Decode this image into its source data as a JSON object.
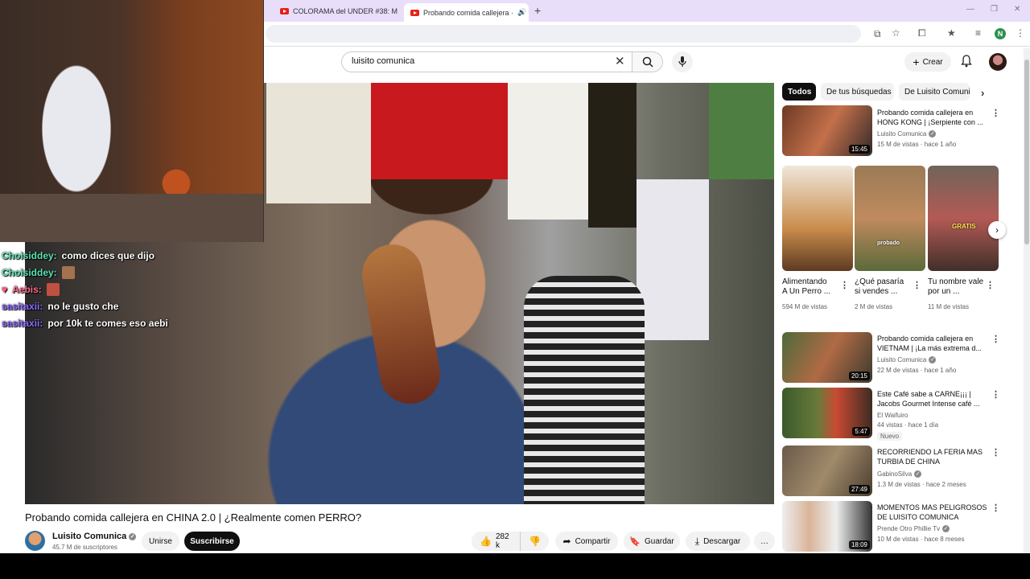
{
  "browser": {
    "tabs": [
      {
        "label": "COLORAMA del UNDER #38: M",
        "active": false
      },
      {
        "label": "Probando comida callejera ·",
        "active": true
      }
    ],
    "profile_initial": "N"
  },
  "masthead": {
    "search_value": "luisito comunica",
    "create_label": "Crear"
  },
  "chat": [
    {
      "user": "Choisiddey:",
      "message": "como dices que dijo",
      "color": "teal"
    },
    {
      "user": "Choisiddey:",
      "message": "",
      "emote": true,
      "color": "teal"
    },
    {
      "user": "Aebis:",
      "message": "",
      "emote": true,
      "color": "pink"
    },
    {
      "user": "sasitaxii:",
      "message": "no le gusto che",
      "color": "purple"
    },
    {
      "user": "sasitaxii:",
      "message": "por 10k te comes eso aebi",
      "color": "purple"
    }
  ],
  "video": {
    "title": "Probando comida callejera en CHINA 2.0 | ¿Realmente comen PERRO?",
    "channel": "Luisito Comunica",
    "subscribers": "45.7 M de suscriptores",
    "join_label": "Unirse",
    "subscribe_label": "Suscribirse",
    "likes": "282 k",
    "share_label": "Compartir",
    "save_label": "Guardar",
    "download_label": "Descargar",
    "more": "…"
  },
  "sidebar": {
    "chips": [
      "Todos",
      "De tus búsquedas",
      "De Luisito Comuni"
    ],
    "videos": [
      {
        "title": "Probando comida callejera en HONG KONG | ¡Serpiente con ...",
        "channel": "Luisito Comunica",
        "meta": "15 M de vistas · hace 1 año",
        "duration": "15:45"
      },
      {
        "title": "Probando comida callejera en VIETNAM | ¡La más extrema d...",
        "channel": "Luisito Comunica",
        "meta": "22 M de vistas · hace 1 año",
        "duration": "20:15"
      },
      {
        "title": "Este Café sabe a CARNE¡¡¡ | Jacobs Gourmet Intense café ...",
        "channel": "El Waifuiro",
        "meta": "44 vistas · hace 1 día",
        "duration": "5:47",
        "badge": "Nuevo"
      },
      {
        "title": "RECORRIENDO LA FERIA MAS TURBIA DE CHINA",
        "channel": "GabinoSilva",
        "meta": "1.3 M de vistas · hace 2 meses",
        "duration": "27:49"
      },
      {
        "title": "MOMENTOS MAS PELIGROSOS DE LUISITO COMUNICA",
        "channel": "Prende Otro Phillie Tv",
        "meta": "10 M de vistas · hace 8 meses",
        "duration": "18:09"
      }
    ],
    "shorts": [
      {
        "title": "Alimentando A Un Perro ...",
        "views": "594 M de vistas"
      },
      {
        "title": "¿Qué pasaría si vendes ...",
        "views": "2 M de vistas"
      },
      {
        "title": "Tu nombre vale por un ...",
        "views": "11 M de vistas"
      }
    ],
    "short_overlays": [
      "probado",
      "GRATIS"
    ]
  }
}
